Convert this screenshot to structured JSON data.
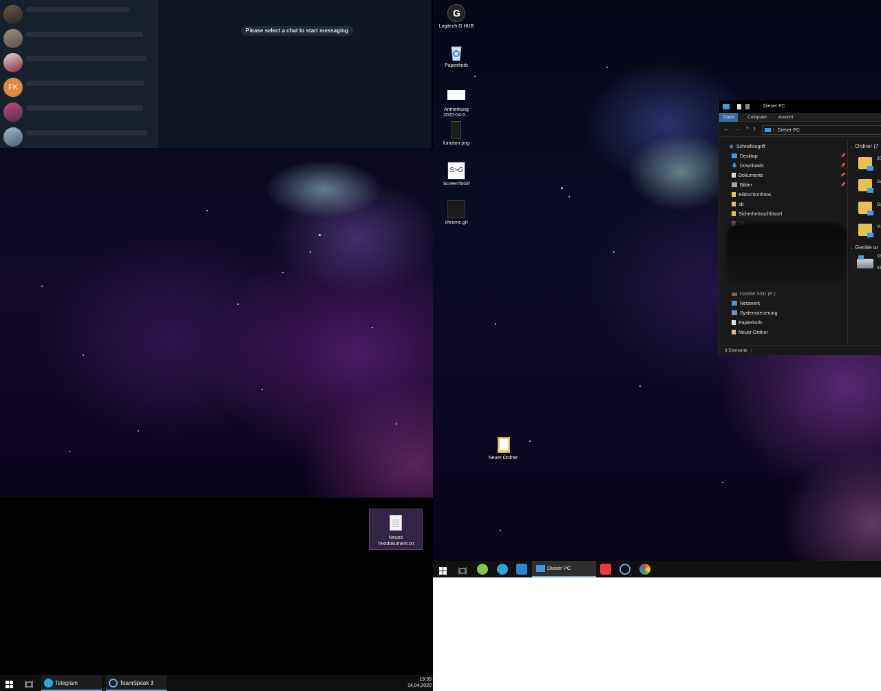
{
  "left_monitor": {
    "telegram": {
      "placeholder_message": "Please select a chat to start messaging",
      "visible_avatar_initials": "FK",
      "accent_color": "#e0883f"
    },
    "desktop_file": {
      "label_line1": "Neues",
      "label_line2": "Textdokument.txt"
    },
    "taskbar": {
      "apps": [
        {
          "label": "Telegram",
          "icon": "telegram-icon"
        },
        {
          "label": "TeamSpeak 3",
          "icon": "teamspeak-icon"
        }
      ],
      "clock_time": "19:35",
      "clock_date": "14.04.2020"
    }
  },
  "right_monitor": {
    "desktop_icons": [
      {
        "label": "Logitech G HUB",
        "icon": "logitech-icon"
      },
      {
        "label": "Papierkorb",
        "icon": "recycle-bin-icon"
      },
      {
        "label": "Anmerkung 2020-04-0...",
        "icon": "image-file-icon"
      },
      {
        "label": "function.png",
        "icon": "image-file-icon"
      },
      {
        "label": "ScreenToGif",
        "icon": "screentogif-icon"
      },
      {
        "label": "chrome.gif",
        "icon": "image-file-icon"
      },
      {
        "label": "Neuer Ordner",
        "icon": "folder-icon"
      }
    ],
    "explorer": {
      "title": "Dieser PC",
      "ribbon_tabs": [
        "Datei",
        "Computer",
        "Ansicht"
      ],
      "address": "Dieser PC",
      "nav_items": [
        {
          "label": "Schnellzugriff",
          "pinned": false
        },
        {
          "label": "Desktop",
          "pinned": true
        },
        {
          "label": "Downloads",
          "pinned": true
        },
        {
          "label": "Dokumente",
          "pinned": true
        },
        {
          "label": "Bilder",
          "pinned": true
        },
        {
          "label": "Bildschirmfotos",
          "pinned": false
        },
        {
          "label": "sb",
          "pinned": false
        },
        {
          "label": "Sicherheitsschlüssel",
          "pinned": false
        },
        {
          "label": "TS",
          "pinned": false
        },
        {
          "label": "Daddel SSD (E:)",
          "pinned": false
        },
        {
          "label": "Netzwerk",
          "pinned": false
        },
        {
          "label": "Systemsteuerung",
          "pinned": false
        },
        {
          "label": "Papierkorb",
          "pinned": false
        },
        {
          "label": "Neuer Ordner",
          "pinned": false
        }
      ],
      "group_folders": "Ordner (7",
      "group_devices": "Geräte ur",
      "folder_snippets": [
        "3D",
        "De",
        "Do",
        "Vi"
      ],
      "device_snippets": [
        "OS",
        "43"
      ],
      "status": "9 Elemente"
    },
    "taskbar": {
      "active_window": "Dieser PC",
      "pinned_icons": [
        "start-icon",
        "task-view-icon",
        "app-green-icon",
        "telegram-icon",
        "chat-icon",
        "explorer-icon",
        "vivaldi-icon",
        "teamspeak-icon",
        "paint-icon"
      ]
    }
  }
}
